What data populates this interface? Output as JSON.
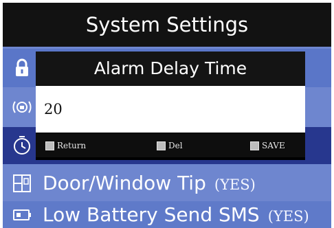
{
  "title": "System Settings",
  "dialog": {
    "title": "Alarm Delay Time",
    "value": "20",
    "softkeys": {
      "return_label": "Return",
      "del_label": "Del",
      "save_label": "SAVE"
    }
  },
  "rows": {
    "door_window": {
      "label": "Door/Window Tip",
      "value": "(YES)"
    },
    "low_battery": {
      "label": "Low Battery Send SMS",
      "value": "(YES)"
    }
  },
  "icons": {
    "lock": "lock-icon",
    "alarm": "alarm-bell-icon",
    "delay": "timer-icon",
    "door": "door-window-icon",
    "battery": "battery-icon"
  },
  "colors": {
    "title_bar": "#121212",
    "menu_row": "#6e86cf",
    "selected_row": "#27378e",
    "dialog_bg": "#141414",
    "input_bg": "#ffffff"
  }
}
